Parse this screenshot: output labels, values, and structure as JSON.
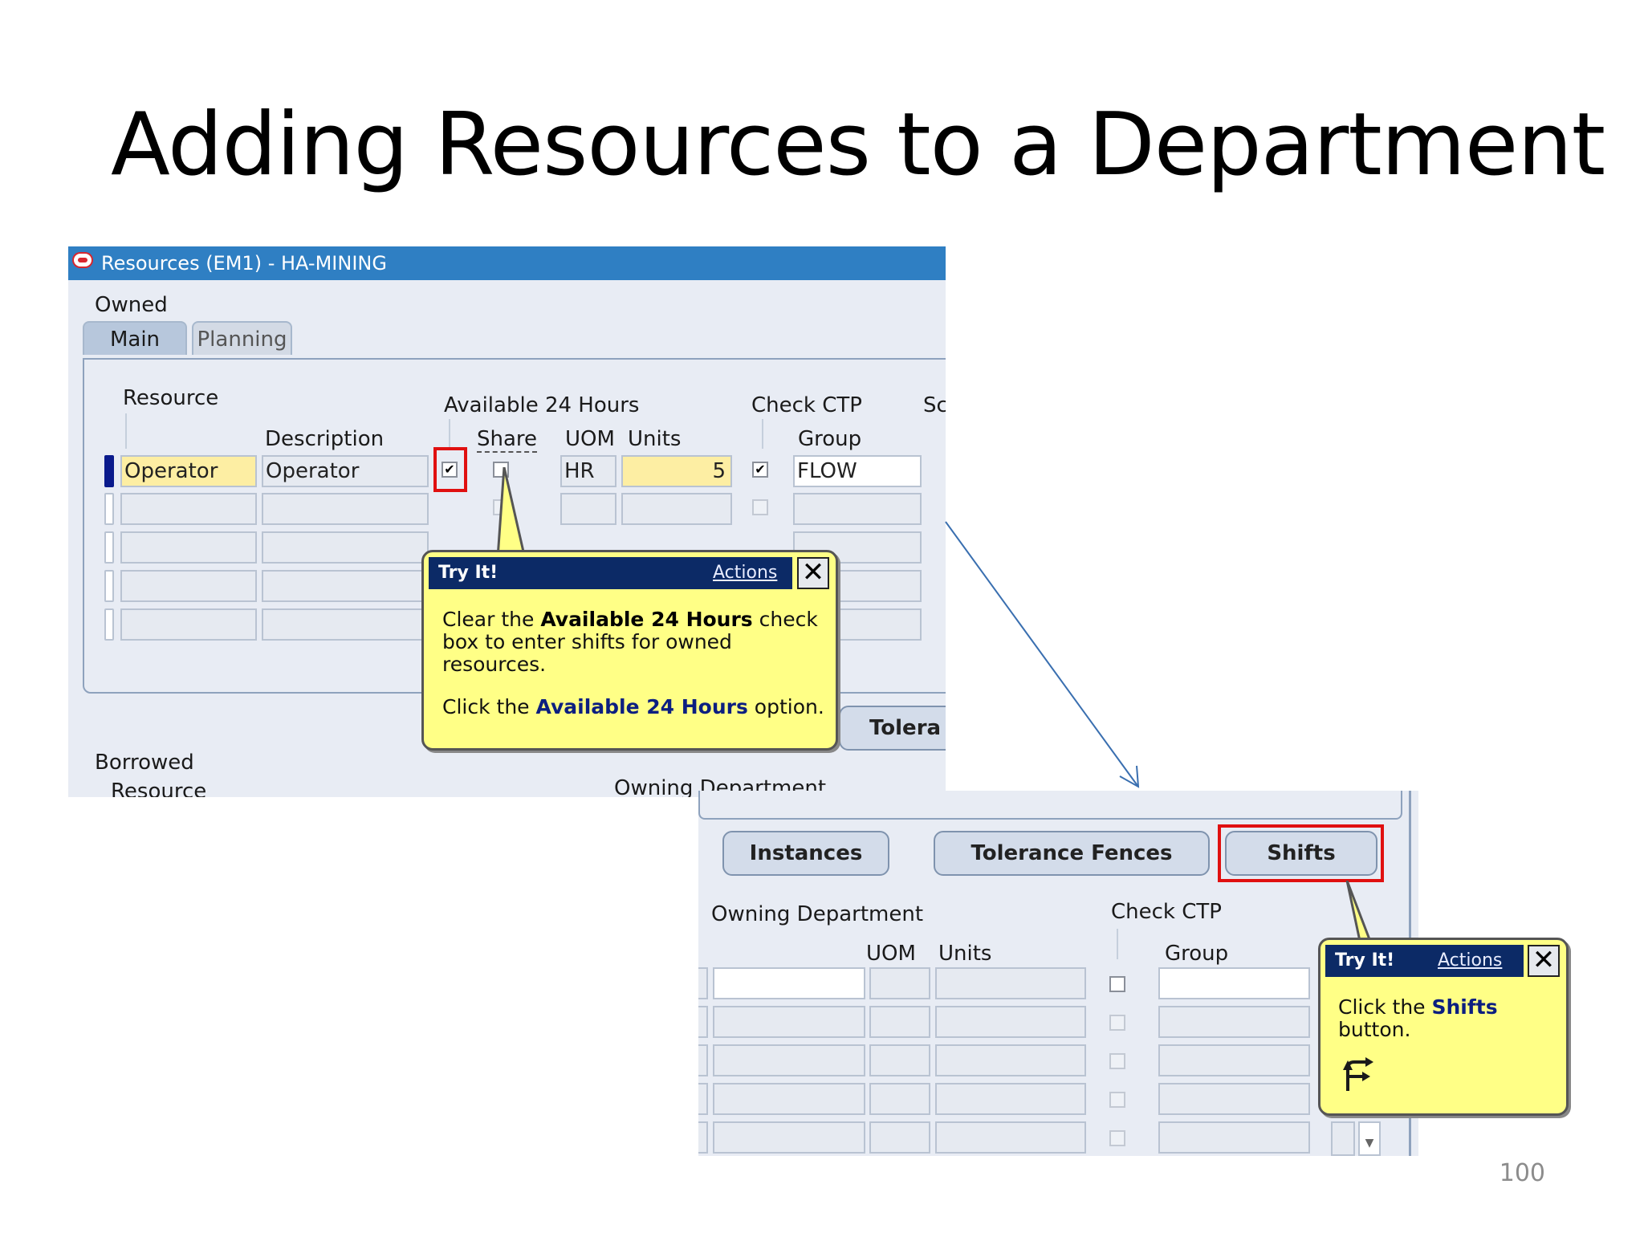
{
  "slide": {
    "title": "Adding Resources to a Department",
    "page_number": "100"
  },
  "window1": {
    "title": "Resources (EM1) - HA-MINING",
    "owned_label": "Owned",
    "tabs": [
      {
        "label": "Main"
      },
      {
        "label": "Planning"
      }
    ],
    "headers": {
      "resource": "Resource",
      "description": "Description",
      "available_24": "Available 24 Hours",
      "share": "Share",
      "uom": "UOM",
      "units": "Units",
      "check_ctp": "Check CTP",
      "group": "Group",
      "sc": "Sc"
    },
    "row1": {
      "resource": "Operator",
      "description": "Operator",
      "uom": "HR",
      "units": "5",
      "group": "FLOW",
      "available_24": true,
      "share": false,
      "check_ctp": true
    },
    "tolerance_partial": "Tolera",
    "borrowed_label": "Borrowed",
    "borrowed_resource": "Resource",
    "owning_department_partial": "Owning Department",
    "bubble": {
      "try_it": "Try It!",
      "actions": "Actions",
      "line1_pre": "Clear the ",
      "line1_bold": "Available 24 Hours",
      "line1_post": " check",
      "line2": "box to enter shifts for owned",
      "line3": "resources.",
      "line4_pre": "Click the ",
      "line4_bold": "Available 24 Hours",
      "line4_post": " option."
    }
  },
  "window2": {
    "buttons": {
      "instances": "Instances",
      "tolerance_fences": "Tolerance Fences",
      "shifts": "Shifts"
    },
    "headers": {
      "owning_department": "Owning Department",
      "uom": "UOM",
      "units": "Units",
      "check_ctp": "Check CTP",
      "group": "Group"
    },
    "bubble": {
      "try_it": "Try It!",
      "actions": "Actions",
      "line1_pre": "Click the ",
      "line1_bold": "Shifts",
      "line2": "button."
    }
  },
  "colors": {
    "titlebar": "#2f7fc3",
    "highlight": "#e01010",
    "bubble": "#ffff86",
    "bubble_head": "#0c2a66"
  }
}
